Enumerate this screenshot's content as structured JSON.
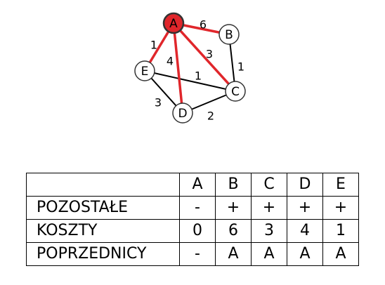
{
  "graph": {
    "nodes": [
      {
        "id": "A",
        "label": "A",
        "highlight": true
      },
      {
        "id": "B",
        "label": "B"
      },
      {
        "id": "C",
        "label": "C"
      },
      {
        "id": "D",
        "label": "D"
      },
      {
        "id": "E",
        "label": "E"
      }
    ],
    "edges": [
      {
        "from": "A",
        "to": "B",
        "weight": "6",
        "highlight": true
      },
      {
        "from": "A",
        "to": "E",
        "weight": "1",
        "highlight": true
      },
      {
        "from": "A",
        "to": "D",
        "weight": "4",
        "highlight": true
      },
      {
        "from": "A",
        "to": "C",
        "weight": "3",
        "highlight": true
      },
      {
        "from": "B",
        "to": "C",
        "weight": "1"
      },
      {
        "from": "E",
        "to": "C",
        "weight": "1"
      },
      {
        "from": "E",
        "to": "D",
        "weight": "3"
      },
      {
        "from": "D",
        "to": "C",
        "weight": "2"
      }
    ],
    "colors": {
      "highlight": "#e0262b",
      "edge": "#000000",
      "node_fill": "#ffffff"
    }
  },
  "table": {
    "columns": [
      "A",
      "B",
      "C",
      "D",
      "E"
    ],
    "rows": [
      {
        "label": "POZOSTAŁE",
        "cells": [
          "-",
          "+",
          "+",
          "+",
          "+"
        ]
      },
      {
        "label": "KOSZTY",
        "cells": [
          "0",
          "6",
          "3",
          "4",
          "1"
        ]
      },
      {
        "label": "POPRZEDNICY",
        "cells": [
          "-",
          "A",
          "A",
          "A",
          "A"
        ]
      }
    ]
  }
}
